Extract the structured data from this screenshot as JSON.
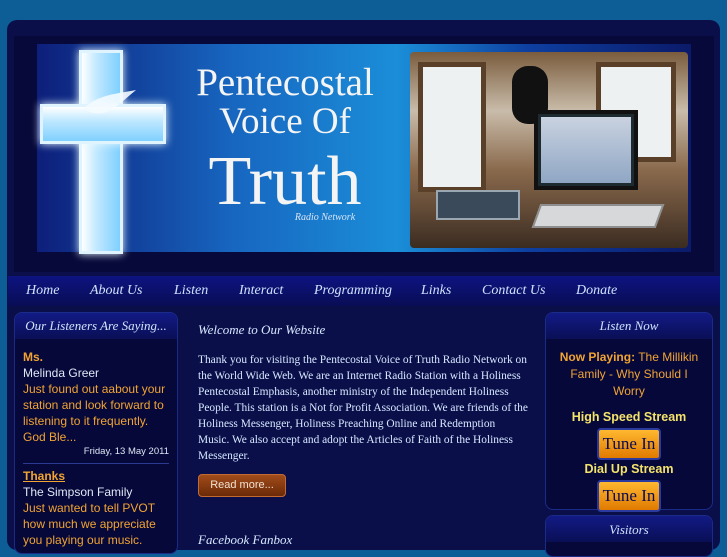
{
  "banner": {
    "title_line1": "Pentecostal",
    "title_line2": "Voice Of",
    "title_line3": "Truth",
    "subtitle": "Radio Network"
  },
  "nav": {
    "items": [
      "Home",
      "About Us",
      "Listen",
      "Interact",
      "Programming",
      "Links",
      "Contact Us",
      "Donate"
    ]
  },
  "left_panel": {
    "title": "Our Listeners Are Saying...",
    "testimonials": [
      {
        "heading": "Ms.",
        "name": "Melinda Greer",
        "text": "Just found out aabout your station and look forward to listening to it frequently. God Ble...",
        "date": "Friday, 13 May 2011"
      },
      {
        "heading": "Thanks",
        "name": "The Simpson Family",
        "text": "Just wanted to tell PVOT how much we appreciate you playing our music."
      }
    ]
  },
  "main": {
    "title": "Welcome to Our Website",
    "body": "Thank you for visiting the Pentecostal Voice of Truth Radio Network on the World Wide Web. We are an Internet Radio Station with a Holiness Pentecostal Emphasis, another ministry of the Independent Holiness People. This station is a Not for Profit Association. We are friends of the Holiness Messenger, Holiness Preaching Online and Redemption Music. We also accept and adopt the Articles of Faith of the Holiness Messenger.",
    "read_more": "Read more...",
    "facebook_title": "Facebook Fanbox"
  },
  "right_panel": {
    "title": "Listen Now",
    "now_playing_label": "Now Playing:",
    "now_playing_value": "The Millikin Family - Why Should I Worry",
    "high_speed_label": "High Speed Stream",
    "dial_up_label": "Dial Up Stream",
    "tune_in": "Tune In"
  },
  "right_panel2": {
    "title": "Visitors"
  }
}
